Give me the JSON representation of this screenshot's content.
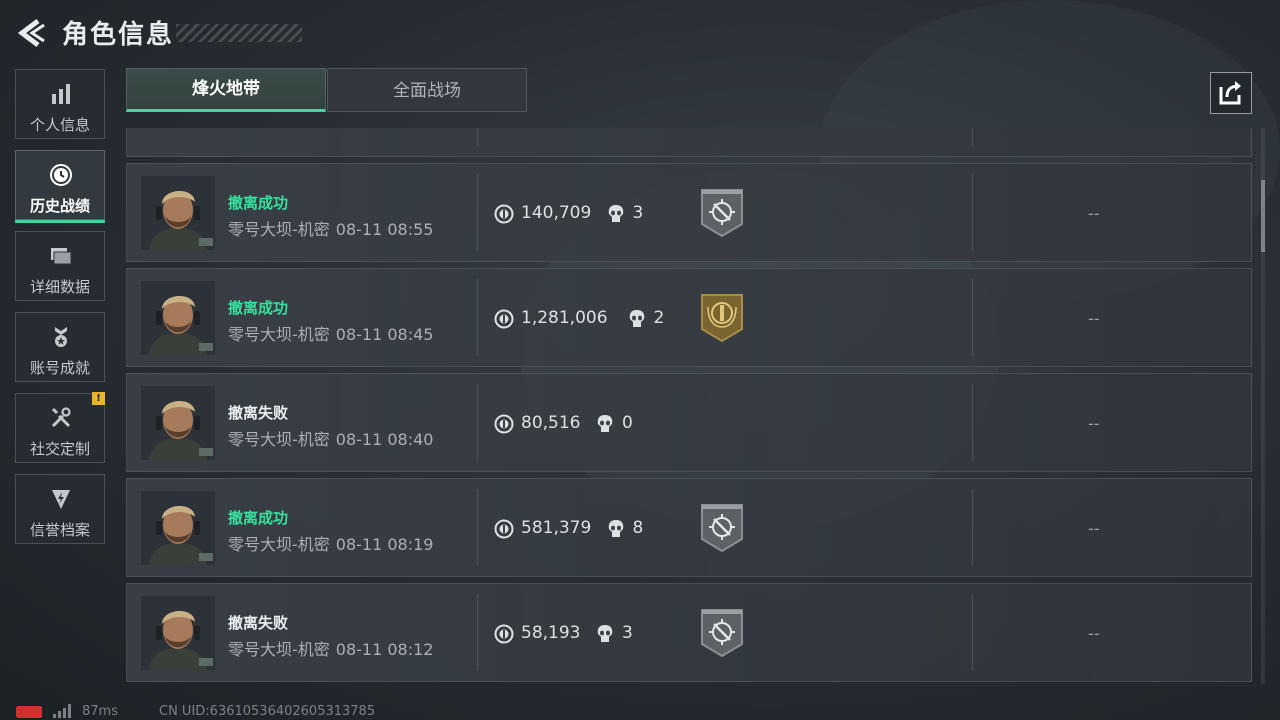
{
  "header": {
    "title": "角色信息"
  },
  "sidebar": {
    "items": [
      {
        "label": "个人信息",
        "icon": "bar-chart-icon"
      },
      {
        "label": "历史战绩",
        "icon": "history-clock-icon"
      },
      {
        "label": "详细数据",
        "icon": "folder-icon"
      },
      {
        "label": "账号成就",
        "icon": "achievement-icon"
      },
      {
        "label": "社交定制",
        "icon": "tools-icon",
        "badge": "!"
      },
      {
        "label": "信誉档案",
        "icon": "shield-bolt-icon"
      }
    ],
    "active_index": 1
  },
  "tabs": [
    {
      "label": "烽火地带"
    },
    {
      "label": "全面战场"
    }
  ],
  "records": [
    {
      "status": "撤离成功",
      "success": true,
      "map": "零号大坝-机密",
      "time": "08-11 08:55",
      "value": "140,709",
      "kills": "3",
      "medal": "silver-crosshair-medal"
    },
    {
      "status": "撤离成功",
      "success": true,
      "map": "零号大坝-机密",
      "time": "08-11 08:45",
      "value": "1,281,006",
      "kills": "2",
      "medal": "gold-emblem-medal"
    },
    {
      "status": "撤离失败",
      "success": false,
      "map": "零号大坝-机密",
      "time": "08-11 08:40",
      "value": "80,516",
      "kills": "0",
      "medal": ""
    },
    {
      "status": "撤离成功",
      "success": true,
      "map": "零号大坝-机密",
      "time": "08-11 08:19",
      "value": "581,379",
      "kills": "8",
      "medal": "silver-crosshair-medal"
    },
    {
      "status": "撤离失败",
      "success": false,
      "map": "零号大坝-机密",
      "time": "08-11 08:12",
      "value": "58,193",
      "kills": "3",
      "medal": "silver-crosshair-medal"
    }
  ],
  "placeholder": "--",
  "footer": {
    "ping": "87ms",
    "uid": "CN UID:636105364026053137​85"
  },
  "colors": {
    "accent": "#3fd3a0",
    "success_text": "#38e09f",
    "badge": "#e8b62a",
    "battery": "#d22f2f"
  }
}
